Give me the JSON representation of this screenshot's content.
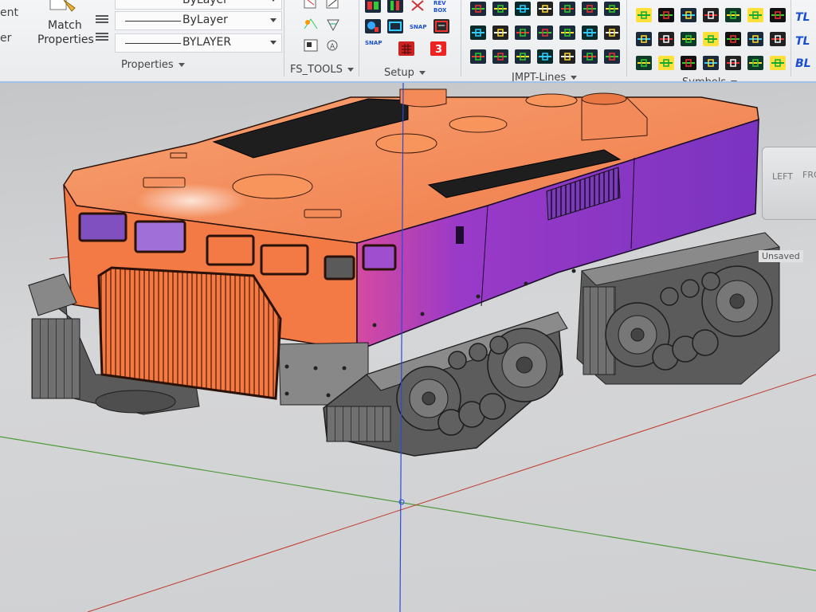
{
  "ribbon": {
    "left_cut_labels": [
      "ent",
      "er"
    ],
    "match_properties": {
      "line1": "Match",
      "line2": "Properties"
    },
    "properties": {
      "top_partial": "ByLayer",
      "linetype": "ByLayer",
      "lineweight": "BYLAYER",
      "panel_label": "Properties"
    },
    "fs_tools": {
      "panel_label": "FS_TOOLS"
    },
    "setup": {
      "panel_label": "Setup",
      "snap_label": "SNAP",
      "snap_label2": "SNAP",
      "revbox_label": "REV BOX"
    },
    "jmpt_lines": {
      "panel_label": "JMPT-Lines"
    },
    "symbols": {
      "panel_label": "Symbols"
    },
    "side_abbr": [
      "TL",
      "TL",
      "BL"
    ]
  },
  "viewport": {
    "viewcube": {
      "face": "LEFT",
      "face2": "FRO"
    },
    "visual_style": "Unsaved"
  },
  "colors": {
    "ribbon_bg": "#eceef0",
    "ribbon_border": "#9ec3e6",
    "viewport_bg": "#cfd0d2",
    "model_orange": "#f47a45",
    "model_purple": "#8a39c4",
    "track_gray": "#6c6c6c",
    "axis_blue": "#2a4bd8",
    "axis_green": "#4f9a3a",
    "axis_red": "#c0392b"
  }
}
